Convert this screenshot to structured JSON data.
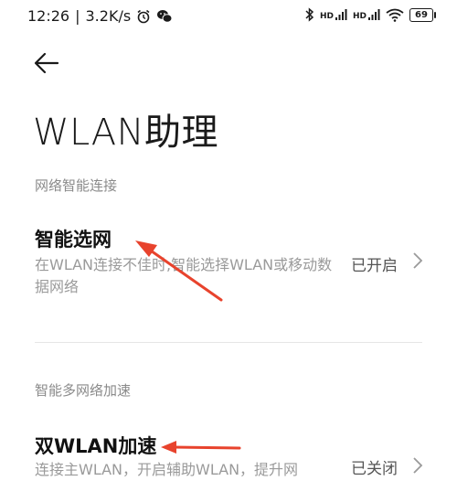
{
  "status_bar": {
    "time": "12:26",
    "speed": "3.2K/s",
    "signal1_label": "HD",
    "signal2_label": "HD",
    "battery": "69",
    "icons": [
      "alarm-icon",
      "wechat-icon",
      "bluetooth-icon",
      "signal-icon",
      "wifi-icon",
      "battery-icon"
    ]
  },
  "header": {
    "back_icon": "back-arrow-icon",
    "title": "WLAN助理"
  },
  "sections": [
    {
      "header": "网络智能连接",
      "items": [
        {
          "title": "智能选网",
          "description": "在WLAN连接不佳时,智能选择WLAN或移动数据网络",
          "value": "已开启"
        }
      ]
    },
    {
      "header": "智能多网络加速",
      "items": [
        {
          "title": "双WLAN加速",
          "description": "连接主WLAN，开启辅助WLAN，提升网",
          "value": "已关闭"
        }
      ]
    }
  ],
  "colors": {
    "annotation_arrow": "#e8432d",
    "section_header": "#8a8a8a",
    "description": "#9a9a9a"
  }
}
